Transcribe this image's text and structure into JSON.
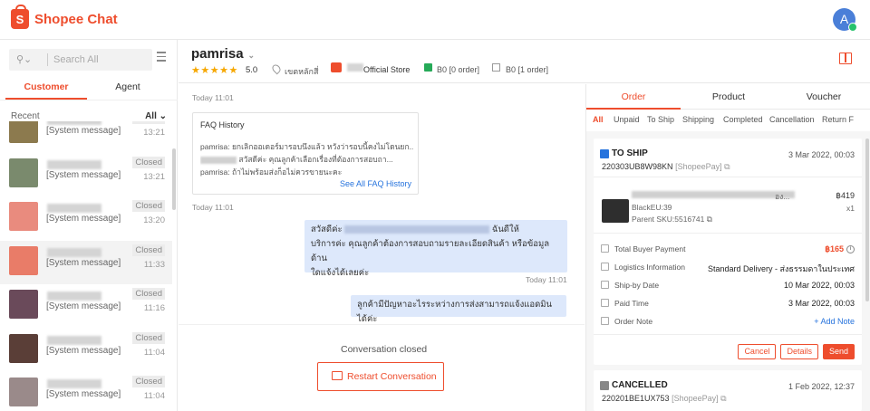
{
  "app": {
    "logo_text": "Shopee Chat",
    "logo_letter": "S",
    "user_avatar_letter": "A",
    "brand_color": "#ee4d2d"
  },
  "sidebar": {
    "search_placeholder": "Search All",
    "tabs": [
      "Customer",
      "Agent"
    ],
    "recent_label": "Recent",
    "filter_label": "All ⌄",
    "conversations": [
      {
        "message": "[System message]",
        "badge": "Closed",
        "time": "13:21",
        "avatar_color": "#8c7a4e"
      },
      {
        "message": "[System message]",
        "badge": "Closed",
        "time": "13:21",
        "avatar_color": "#7a8a6d"
      },
      {
        "message": "[System message]",
        "badge": "Closed",
        "time": "13:20",
        "avatar_color": "#e98b7e"
      },
      {
        "message": "[System message]",
        "badge": "Closed",
        "time": "11:33",
        "avatar_color": "#e97c68"
      },
      {
        "message": "[System message]",
        "badge": "Closed",
        "time": "11:16",
        "avatar_color": "#6a4a5a"
      },
      {
        "message": "[System message]",
        "badge": "Closed",
        "time": "11:04",
        "avatar_color": "#5a3e37"
      },
      {
        "message": "[System message]",
        "badge": "Closed",
        "time": "11:04",
        "avatar_color": "#9a8a8a"
      }
    ]
  },
  "header": {
    "username": "pamrisa",
    "stars": "★★★★★",
    "rating": "5.0",
    "location": "เขตหลักสี่",
    "store": "Official Store",
    "b0_order_a": "B0 [0 order]",
    "b0_order_b": "B0 [1 order]"
  },
  "chat": {
    "timestamp_top": "Today 11:01",
    "faq_title": "FAQ History",
    "faq_lines": [
      "pamrisa: ยกเลิกออเดอร์มารอบนึงแล้ว หวังว่ารอบนี้คงไม่โดนยก...",
      "สวัสดีค่ะ คุณลูกค้าเลือกเรื่องที่ต้องการสอบถา...",
      "pamrisa: ถ้าไม่พร้อมส่งก็อไม่ควรขายนะคะ"
    ],
    "faq_more": "See All FAQ History",
    "timestamp_faq": "Today 11:01",
    "msg1_start": "สวัสดีค่ะ",
    "msg1_end": "ฉันดีให้",
    "msg1_line2": "บริการค่ะ คุณลูกค้าต้องการสอบถามรายละเอียดสินค้า หรือข้อมูลด้าน",
    "msg1_line3": "ใดแจ้งได้เลยค่ะ",
    "timestamp_msg1": "Today 11:01",
    "msg2": "ลูกค้ามีปัญหาอะไรระหว่างการส่งสามารถแจ้งแอดมินได้ค่ะ",
    "closed_text": "Conversation closed",
    "restart_label": "Restart Conversation"
  },
  "order_panel": {
    "tabs": [
      "Order",
      "Product",
      "Voucher"
    ],
    "subtabs": [
      "All",
      "Unpaid",
      "To Ship",
      "Shipping",
      "Completed",
      "Cancellation",
      "Return F"
    ],
    "order1": {
      "status": "TO SHIP",
      "date": "3 Mar 2022, 00:03",
      "order_no": "220303UB8W98KN",
      "pay": "[ShopeePay]",
      "product_suffix": "อง...",
      "price": "฿419",
      "qty": "x1",
      "variation": "BlackEU:39",
      "sku": "Parent SKU:5516741",
      "rows": [
        {
          "label": "Total Buyer Payment",
          "value": "฿165"
        },
        {
          "label": "Logistics Information",
          "value": "Standard Delivery - ส่งธรรมดาในประเทศ"
        },
        {
          "label": "Ship-by Date",
          "value": "10 Mar 2022, 00:03"
        },
        {
          "label": "Paid Time",
          "value": "3 Mar 2022, 00:03"
        },
        {
          "label": "Order Note",
          "value": "+ Add Note"
        }
      ],
      "buttons": [
        "Cancel",
        "Details",
        "Send"
      ]
    },
    "order2": {
      "status": "CANCELLED",
      "date": "1 Feb 2022, 12:37",
      "order_no": "220201BE1UX753",
      "pay": "[ShopeePay]"
    }
  }
}
